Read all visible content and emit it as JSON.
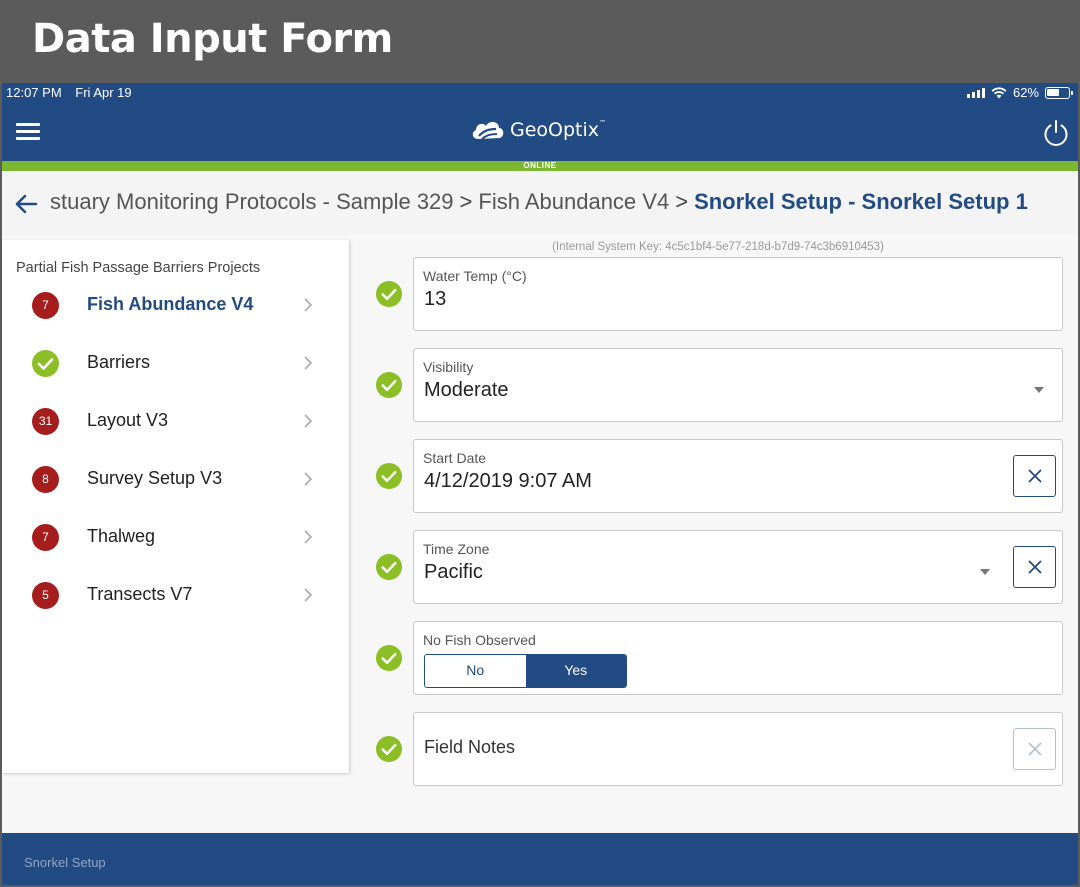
{
  "window_title": "Data Input Form",
  "status_bar": {
    "time": "12:07 PM",
    "date": "Fri Apr 19",
    "battery": "62%",
    "battery_level": 0.62
  },
  "app": {
    "logo_text": "GeoOptix",
    "logo_mark": "™",
    "connection_status": "ONLINE"
  },
  "breadcrumb": {
    "items": [
      "stuary Monitoring Protocols - Sample 329",
      "Fish Abundance V4",
      "Snorkel Setup - Snorkel Setup 1"
    ],
    "separator": ">"
  },
  "sidebar": {
    "title": "Partial Fish Passage Barriers Projects",
    "items": [
      {
        "label": "Fish Abundance V4",
        "badge": "7",
        "status": "error",
        "active": true
      },
      {
        "label": "Barriers",
        "badge": "",
        "status": "complete",
        "active": false
      },
      {
        "label": "Layout V3",
        "badge": "31",
        "status": "error",
        "active": false
      },
      {
        "label": "Survey Setup V3",
        "badge": "8",
        "status": "error",
        "active": false
      },
      {
        "label": "Thalweg",
        "badge": "7",
        "status": "error",
        "active": false
      },
      {
        "label": "Transects V7",
        "badge": "5",
        "status": "error",
        "active": false
      }
    ]
  },
  "form": {
    "system_key": "(Internal System Key: 4c5c1bf4-5e77-218d-b7d9-74c3b6910453)",
    "fields": {
      "water_temp": {
        "label": "Water Temp (°C)",
        "value": "13"
      },
      "visibility": {
        "label": "Visibility",
        "value": "Moderate"
      },
      "start_date": {
        "label": "Start Date",
        "value": "4/12/2019 9:07 AM"
      },
      "time_zone": {
        "label": "Time Zone",
        "value": "Pacific"
      },
      "no_fish_observed": {
        "label": "No Fish Observed",
        "options": [
          "No",
          "Yes"
        ],
        "selected": "Yes"
      },
      "field_notes": {
        "label": "Field Notes",
        "value": ""
      }
    }
  },
  "footer": {
    "label": "Snorkel Setup"
  },
  "colors": {
    "primary": "#234b83",
    "online": "#7cb82f",
    "badge_error": "#a51d1d",
    "check": "#8cbf26"
  }
}
